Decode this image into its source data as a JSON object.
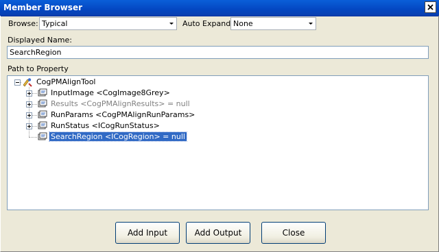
{
  "window": {
    "title": "Member Browser"
  },
  "toolbar": {
    "browse_label": "Browse:",
    "browse_value": "Typical",
    "auto_expand_label": "Auto Expand:",
    "auto_expand_value": "None"
  },
  "displayed_name": {
    "label": "Displayed Name:",
    "value": "SearchRegion"
  },
  "tree": {
    "label": "Path to Property",
    "root": "CogPMAlignTool",
    "items": [
      {
        "label": "InputImage <CogImage8Grey>",
        "state": "normal"
      },
      {
        "label": "Results <CogPMAlignResults> = null",
        "state": "disabled"
      },
      {
        "label": "RunParams <CogPMAlignRunParams>",
        "state": "normal"
      },
      {
        "label": "RunStatus <ICogRunStatus>",
        "state": "normal"
      },
      {
        "label": "SearchRegion <ICogRegion> = null",
        "state": "selected"
      }
    ]
  },
  "buttons": {
    "add_input": "Add Input",
    "add_output": "Add Output",
    "close": "Close"
  },
  "icons": {
    "close": "close-icon",
    "dropdown": "chevron-down-icon",
    "tool": "tool-icon",
    "property": "property-icon"
  },
  "colors": {
    "title_bar": "#0447c2",
    "selection": "#316ac5",
    "dialog_bg": "#ece9d8"
  }
}
